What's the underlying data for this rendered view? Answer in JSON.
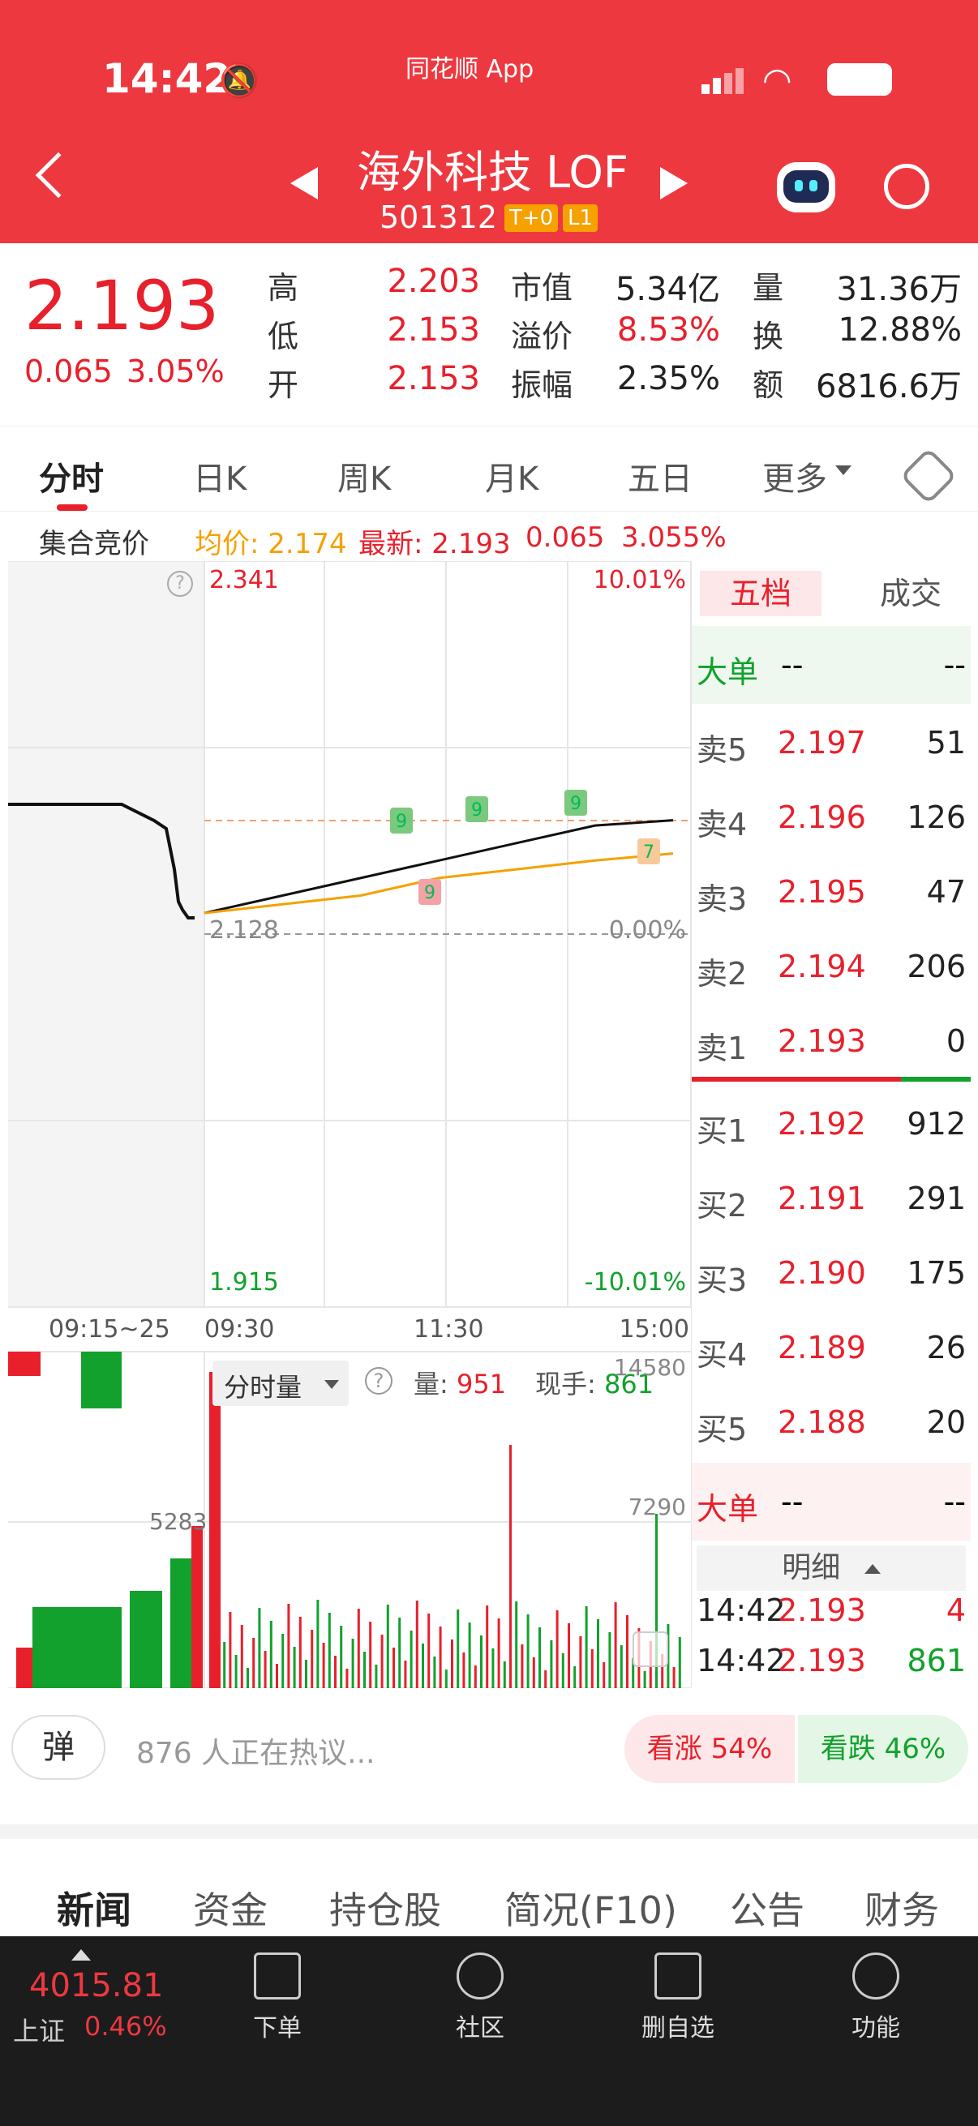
{
  "status_bar": {
    "time": "14:42",
    "app_label": "同花顺 App"
  },
  "header": {
    "title": "海外科技 LOF",
    "code": "501312",
    "badges": [
      "T+0",
      "L1"
    ]
  },
  "quote": {
    "price": "2.193",
    "change": "0.065",
    "change_pct": "3.05%",
    "stats": [
      {
        "label": "高",
        "value": "2.203",
        "color": "red"
      },
      {
        "label": "市值",
        "value": "5.34亿",
        "color": "dark"
      },
      {
        "label": "量",
        "value": "31.36万",
        "color": "dark"
      },
      {
        "label": "低",
        "value": "2.153",
        "color": "red"
      },
      {
        "label": "溢价",
        "value": "8.53%",
        "color": "red"
      },
      {
        "label": "换",
        "value": "12.88%",
        "color": "dark"
      },
      {
        "label": "开",
        "value": "2.153",
        "color": "red"
      },
      {
        "label": "振幅",
        "value": "2.35%",
        "color": "dark"
      },
      {
        "label": "额",
        "value": "6816.6万",
        "color": "dark"
      }
    ]
  },
  "tabs": [
    "分时",
    "日K",
    "周K",
    "月K",
    "五日",
    "更多"
  ],
  "info_row": {
    "label": "集合竞价",
    "avg": "均价: 2.174",
    "latest": "最新: 2.193",
    "chg": "0.065",
    "pct": "3.055%"
  },
  "chart": {
    "top_price": "2.341",
    "top_pct": "10.01%",
    "mid_price": "2.128",
    "mid_pct": "0.00%",
    "bottom_price": "1.915",
    "bottom_pct": "-10.01%",
    "time_labels": [
      "09:15~25",
      "09:30",
      "11:30",
      "15:00"
    ],
    "vol_label": "分时量",
    "vol_text": "量:",
    "vol_value": "951",
    "hand_text": "现手:",
    "hand_value": "861",
    "vol_ticks": [
      "14580",
      "7290",
      "5283"
    ],
    "markers": [
      "9",
      "9",
      "9",
      "9",
      "7"
    ]
  },
  "chart_data": {
    "type": "line",
    "x": [
      "09:30",
      "11:30",
      "15:00"
    ],
    "y_range": [
      1.915,
      2.341
    ],
    "prev_close": 2.128,
    "series": [
      {
        "name": "最新",
        "values": [
          2.14,
          2.15,
          2.16,
          2.17,
          2.18,
          2.19,
          2.193
        ]
      },
      {
        "name": "均价",
        "values": [
          2.14,
          2.145,
          2.15,
          2.16,
          2.165,
          2.17,
          2.174
        ]
      }
    ]
  },
  "book": {
    "tabs": [
      "五档",
      "成交"
    ],
    "big_label": "大单",
    "big_vals": [
      "--",
      "--"
    ],
    "asks": [
      {
        "label": "卖5",
        "price": "2.197",
        "vol": "51"
      },
      {
        "label": "卖4",
        "price": "2.196",
        "vol": "126"
      },
      {
        "label": "卖3",
        "price": "2.195",
        "vol": "47"
      },
      {
        "label": "卖2",
        "price": "2.194",
        "vol": "206"
      },
      {
        "label": "卖1",
        "price": "2.193",
        "vol": "0"
      }
    ],
    "bids": [
      {
        "label": "买1",
        "price": "2.192",
        "vol": "912"
      },
      {
        "label": "买2",
        "price": "2.191",
        "vol": "291"
      },
      {
        "label": "买3",
        "price": "2.190",
        "vol": "175"
      },
      {
        "label": "买4",
        "price": "2.189",
        "vol": "26"
      },
      {
        "label": "买5",
        "price": "2.188",
        "vol": "20"
      }
    ],
    "detail_label": "明细",
    "trades": [
      {
        "time": "14:42",
        "price": "2.193",
        "vol": "4"
      },
      {
        "time": "14:42",
        "price": "2.193",
        "vol": "861"
      }
    ]
  },
  "hot": {
    "btn": "弹",
    "text": "876 人正在热议...",
    "up": "看涨 54%",
    "down": "看跌 46%"
  },
  "news_tabs": [
    "新闻",
    "资金",
    "持仓股",
    "简况(F10)",
    "公告",
    "财务"
  ],
  "nav": {
    "index_value": "4015.81",
    "index_name": "上证",
    "index_pct": "0.46%",
    "items": [
      "下单",
      "社区",
      "删自选",
      "功能"
    ]
  }
}
